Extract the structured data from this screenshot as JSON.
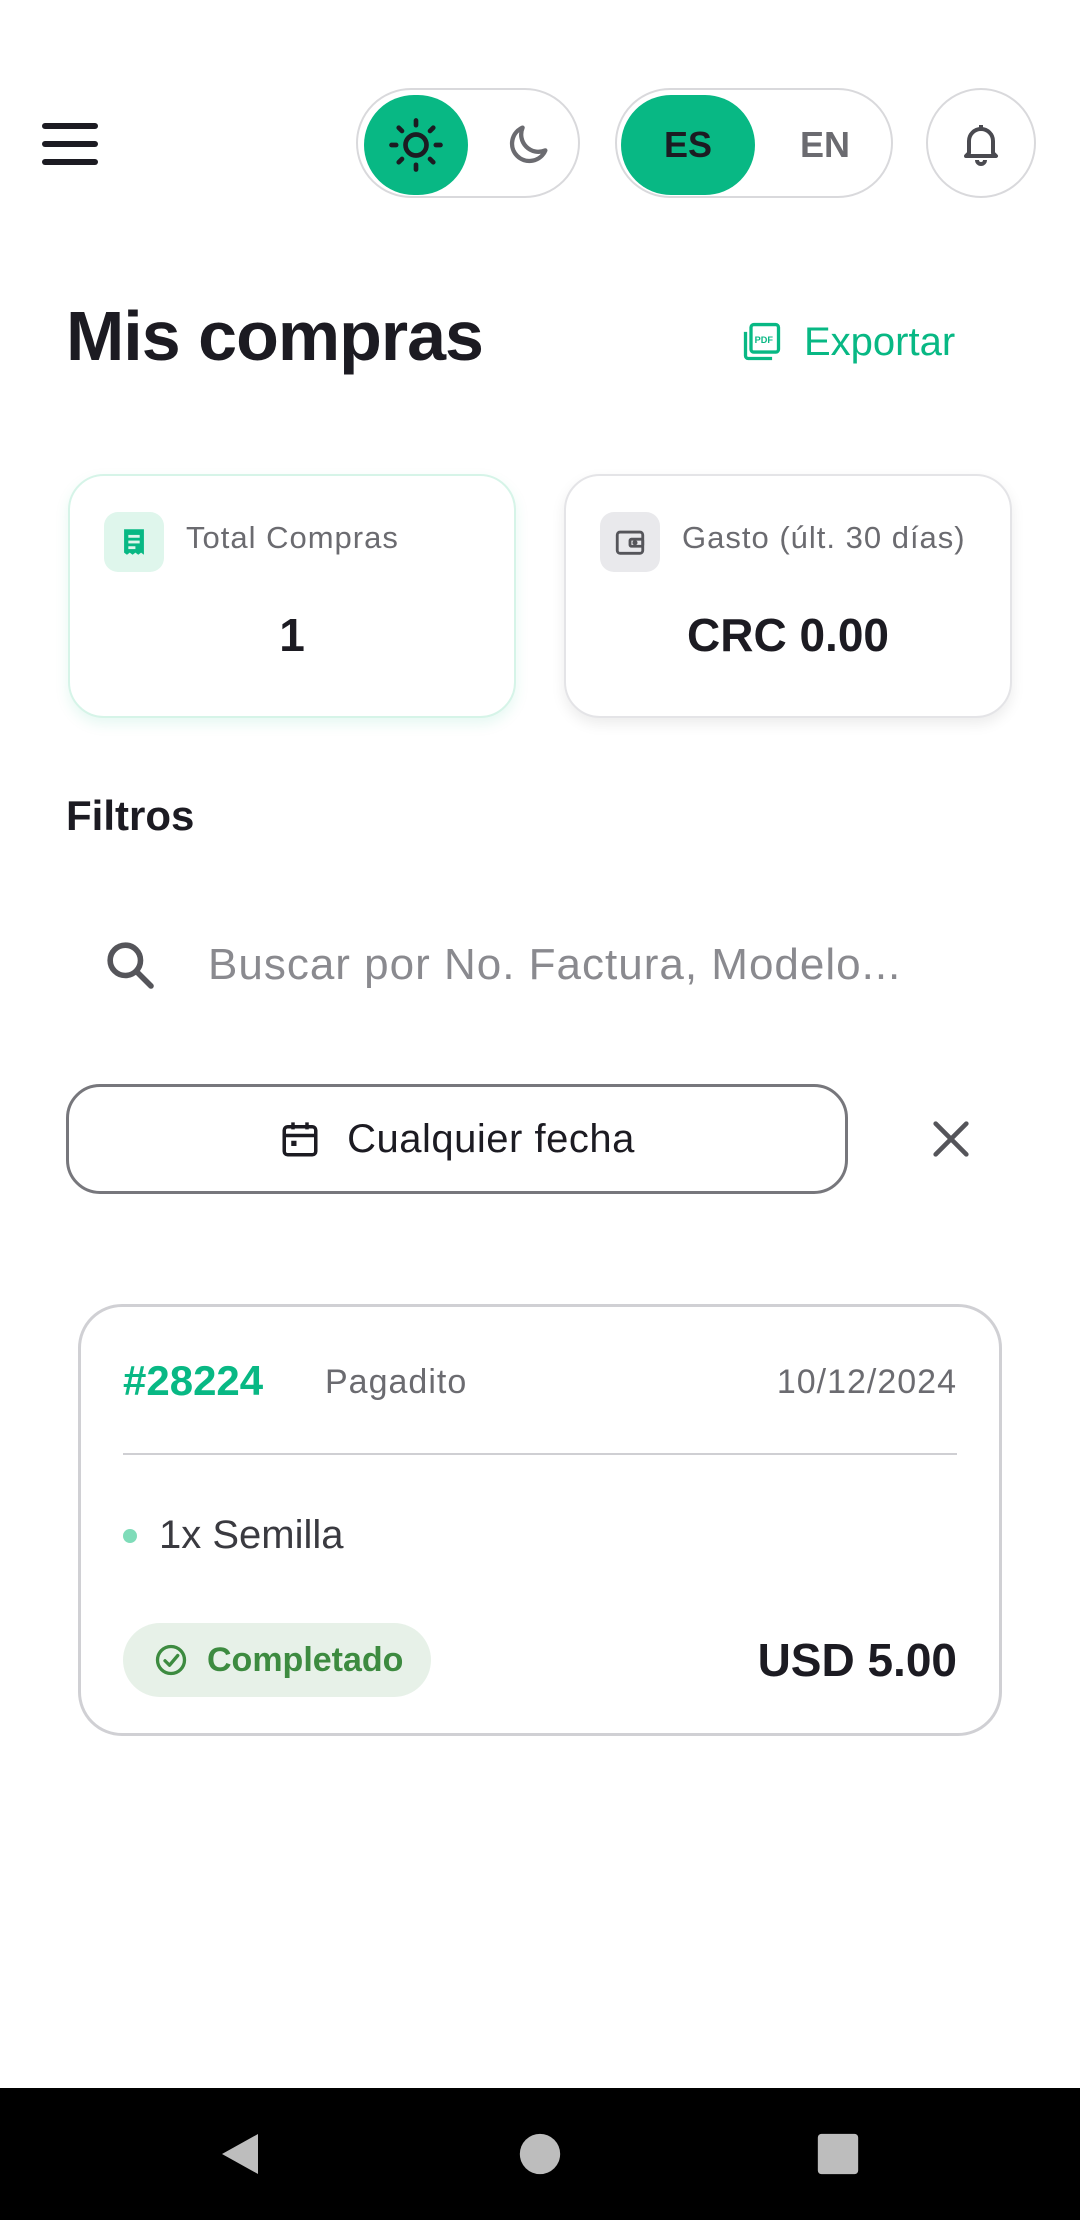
{
  "header": {
    "menu_icon": "hamburger-menu-icon",
    "theme": {
      "light_icon": "sun-icon",
      "dark_icon": "moon-icon",
      "selected": "light"
    },
    "language": {
      "options": [
        "ES",
        "EN"
      ],
      "selected": "ES"
    },
    "notifications_icon": "bell-icon"
  },
  "page": {
    "title": "Mis compras",
    "export_label": "Exportar",
    "export_icon": "pdf-icon"
  },
  "stats": [
    {
      "label": "Total Compras",
      "value": "1",
      "icon": "receipt-icon"
    },
    {
      "label": "Gasto (últ. 30 días)",
      "value": "CRC 0.00",
      "icon": "wallet-icon"
    }
  ],
  "filters": {
    "title": "Filtros",
    "search_placeholder": "Buscar por No. Factura, Modelo...",
    "search_value": "",
    "date_label": "Cualquier fecha",
    "date_icon": "calendar-icon",
    "clear_icon": "close-icon"
  },
  "orders": [
    {
      "number": "#28224",
      "payment_method": "Pagadito",
      "date": "10/12/2024",
      "items": [
        "1x Semilla"
      ],
      "status": "Completado",
      "status_icon": "check-circle-icon",
      "total": "USD 5.00"
    }
  ],
  "colors": {
    "accent": "#08b884",
    "status_bg": "#e7f1e8",
    "status_text": "#3d8b40",
    "text": "#1c1b22",
    "muted": "#6b6b70"
  },
  "system_nav": {
    "back_icon": "back-triangle-icon",
    "home_icon": "home-circle-icon",
    "recents_icon": "recents-square-icon"
  }
}
